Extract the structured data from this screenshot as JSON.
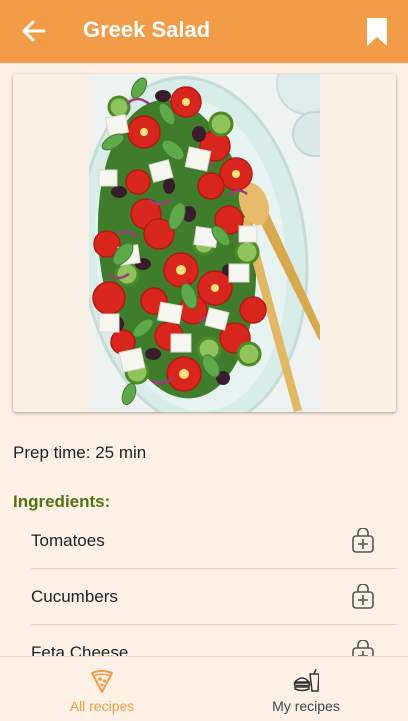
{
  "appbar": {
    "title": "Greek Salad",
    "back_icon": "arrow-left-icon",
    "bookmark_icon": "bookmark-icon"
  },
  "recipe": {
    "image_alt": "Greek salad on a platter",
    "prep_time": "Prep time: 25 min",
    "ingredients_heading": "Ingredients:",
    "ingredients": [
      {
        "name": "Tomatoes",
        "action_icon": "add-to-basket-icon"
      },
      {
        "name": "Cucumbers",
        "action_icon": "add-to-basket-icon"
      },
      {
        "name": "Feta Cheese",
        "action_icon": "add-to-basket-icon"
      }
    ]
  },
  "bottom_nav": {
    "items": [
      {
        "label": "All recipes",
        "icon": "pizza-slice-icon",
        "active": true
      },
      {
        "label": "My recipes",
        "icon": "burger-drink-icon",
        "active": false
      }
    ]
  },
  "colors": {
    "primary": "#f39c47",
    "background": "#fdf1e6",
    "heading_green": "#4e7412"
  }
}
